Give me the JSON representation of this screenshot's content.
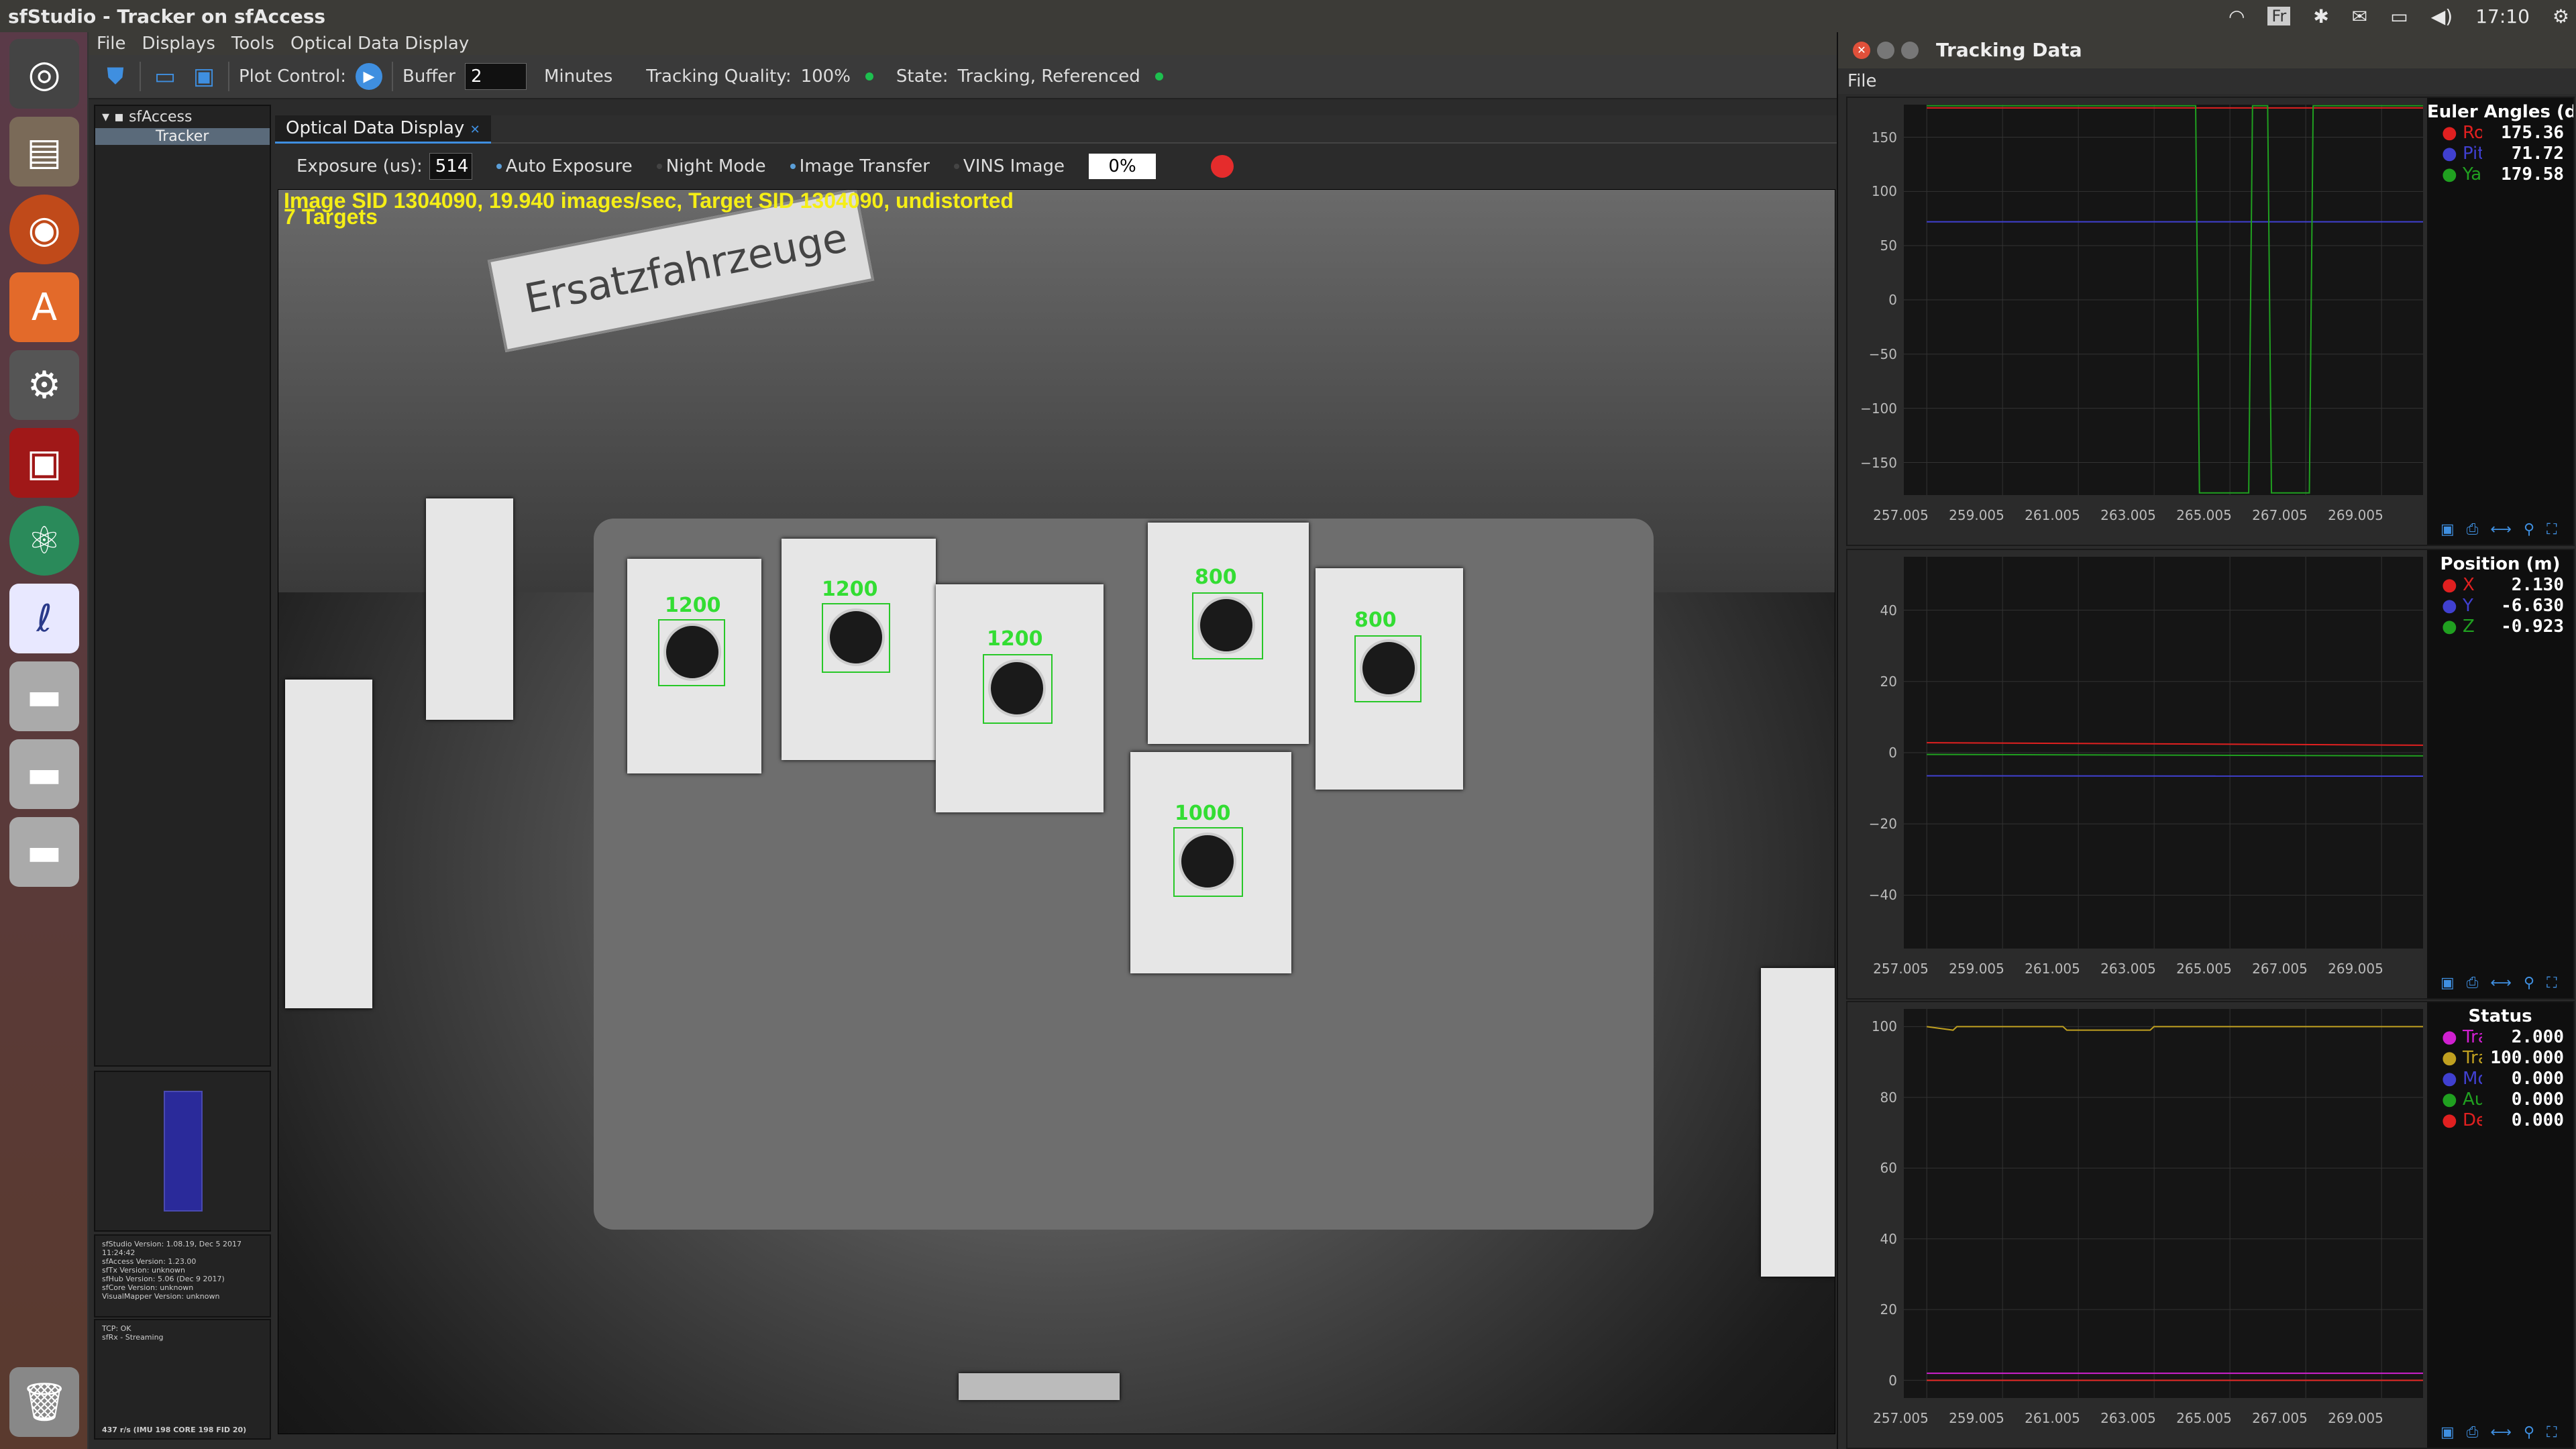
{
  "window": {
    "title": "sfStudio - Tracker on sfAccess"
  },
  "tray": {
    "keyboard": "Fr",
    "time": "17:10"
  },
  "menu": [
    "File",
    "Displays",
    "Tools",
    "Optical Data Display"
  ],
  "toolbar": {
    "plot_control": "Plot Control:",
    "buffer_label": "Buffer",
    "buffer_value": "2",
    "buffer_unit": "Minutes",
    "quality_label": "Tracking Quality:",
    "quality_value": "100%",
    "state_label": "State:",
    "state_value": "Tracking, Referenced"
  },
  "tree": {
    "root": "sfAccess",
    "child": "Tracker"
  },
  "info": {
    "lines": [
      "sfStudio Version: 1.08.19, Dec  5 2017 11:24:42",
      "sfAccess Version: 1.23.00",
      "sfTx Version: unknown",
      "sfHub Version: 5.06 (Dec  9 2017)",
      "sfCore Version: unknown",
      "VisualMapper Version: unknown"
    ],
    "net": [
      "TCP: OK",
      "sfRx - Streaming"
    ],
    "footer": "437 r/s (IMU 198  CORE 198  FID 20)"
  },
  "tab": {
    "label": "Optical Data Display"
  },
  "camera": {
    "exposure_label": "Exposure (us):",
    "exposure_value": "514",
    "auto_exposure": "Auto Exposure",
    "night_mode": "Night Mode",
    "image_transfer": "Image Transfer",
    "vins_image": "VINS Image",
    "progress": "0%",
    "line1": "Image SID 1304090, 19.940 images/sec, Target SID 1304090, undistorted",
    "line2": "7 Targets",
    "sign": "Ersatzfahrzeuge",
    "targets": [
      "1200",
      "1200",
      "1200",
      "800",
      "800",
      "1000"
    ]
  },
  "tracking": {
    "title": "Tracking Data",
    "file_menu": "File",
    "euler": {
      "title": "Euler Angles (de",
      "entries": [
        {
          "name": "Roll",
          "value": "175.36",
          "color": "#e02020"
        },
        {
          "name": "Pitch",
          "value": "71.72",
          "color": "#4040d0"
        },
        {
          "name": "Yaw",
          "value": "179.58",
          "color": "#20a020"
        }
      ],
      "yticks": [
        "150",
        "100",
        "50",
        "0",
        "−50",
        "−100",
        "−150"
      ]
    },
    "position": {
      "title": "Position (m)",
      "entries": [
        {
          "name": "X",
          "value": "2.130",
          "color": "#e02020"
        },
        {
          "name": "Y",
          "value": "-6.630",
          "color": "#4040d0"
        },
        {
          "name": "Z",
          "value": "-0.923",
          "color": "#20a020"
        }
      ],
      "yticks": [
        "40",
        "20",
        "0",
        "−20",
        "−40"
      ]
    },
    "status": {
      "title": "Status",
      "entries": [
        {
          "name": "Tra",
          "value": "2.000",
          "color": "#d020d0"
        },
        {
          "name": "Tra",
          "value": "100.000",
          "color": "#c0a020"
        },
        {
          "name": "Mo",
          "value": "0.000",
          "color": "#4040d0"
        },
        {
          "name": "Aut",
          "value": "0.000",
          "color": "#20a020"
        },
        {
          "name": "De",
          "value": "0.000",
          "color": "#e02020"
        }
      ],
      "yticks": [
        "100",
        "80",
        "60",
        "40",
        "20",
        "0"
      ]
    },
    "xticks": [
      "257.005",
      "259.005",
      "261.005",
      "263.005",
      "265.005",
      "267.005",
      "269.005"
    ]
  },
  "chart_data": [
    {
      "type": "line",
      "title": "Euler Angles (de",
      "x": [
        257.005,
        259.005,
        261.005,
        263.005,
        264.1,
        264.2,
        265.5,
        265.6,
        266.0,
        266.1,
        267.1,
        267.2,
        269.005,
        270.1
      ],
      "series": [
        {
          "name": "Roll",
          "values": [
            177,
            177,
            177,
            177,
            177,
            177,
            177,
            177,
            177,
            177,
            177,
            177,
            177,
            177
          ]
        },
        {
          "name": "Pitch",
          "values": [
            72,
            72,
            72,
            72,
            72,
            72,
            72,
            72,
            72,
            72,
            72,
            72,
            72,
            72
          ]
        },
        {
          "name": "Yaw",
          "values": [
            179,
            179,
            179,
            179,
            179,
            -178,
            -178,
            179,
            179,
            -178,
            -178,
            179,
            179,
            179
          ]
        }
      ],
      "ylim": [
        -180,
        180
      ]
    },
    {
      "type": "line",
      "title": "Position (m)",
      "x": [
        257.005,
        270.1
      ],
      "series": [
        {
          "name": "X",
          "values": [
            2.8,
            2.1
          ]
        },
        {
          "name": "Y",
          "values": [
            -6.5,
            -6.6
          ]
        },
        {
          "name": "Z",
          "values": [
            -0.5,
            -0.9
          ]
        }
      ],
      "ylim": [
        -55,
        55
      ]
    },
    {
      "type": "line",
      "title": "Status",
      "x": [
        257.005,
        257.7,
        257.8,
        260.6,
        260.7,
        262.9,
        263.0,
        270.1
      ],
      "series": [
        {
          "name": "Tra",
          "values": [
            2,
            2,
            2,
            2,
            2,
            2,
            2,
            2
          ]
        },
        {
          "name": "Tra",
          "values": [
            100,
            99,
            100,
            100,
            99,
            99,
            100,
            100
          ]
        },
        {
          "name": "Mo",
          "values": [
            0,
            0,
            0,
            0,
            0,
            0,
            0,
            0
          ]
        },
        {
          "name": "Aut",
          "values": [
            0,
            0,
            0,
            0,
            0,
            0,
            0,
            0
          ]
        },
        {
          "name": "De",
          "values": [
            0,
            0,
            0,
            0,
            0,
            0,
            0,
            0
          ]
        }
      ],
      "ylim": [
        -5,
        105
      ]
    }
  ]
}
